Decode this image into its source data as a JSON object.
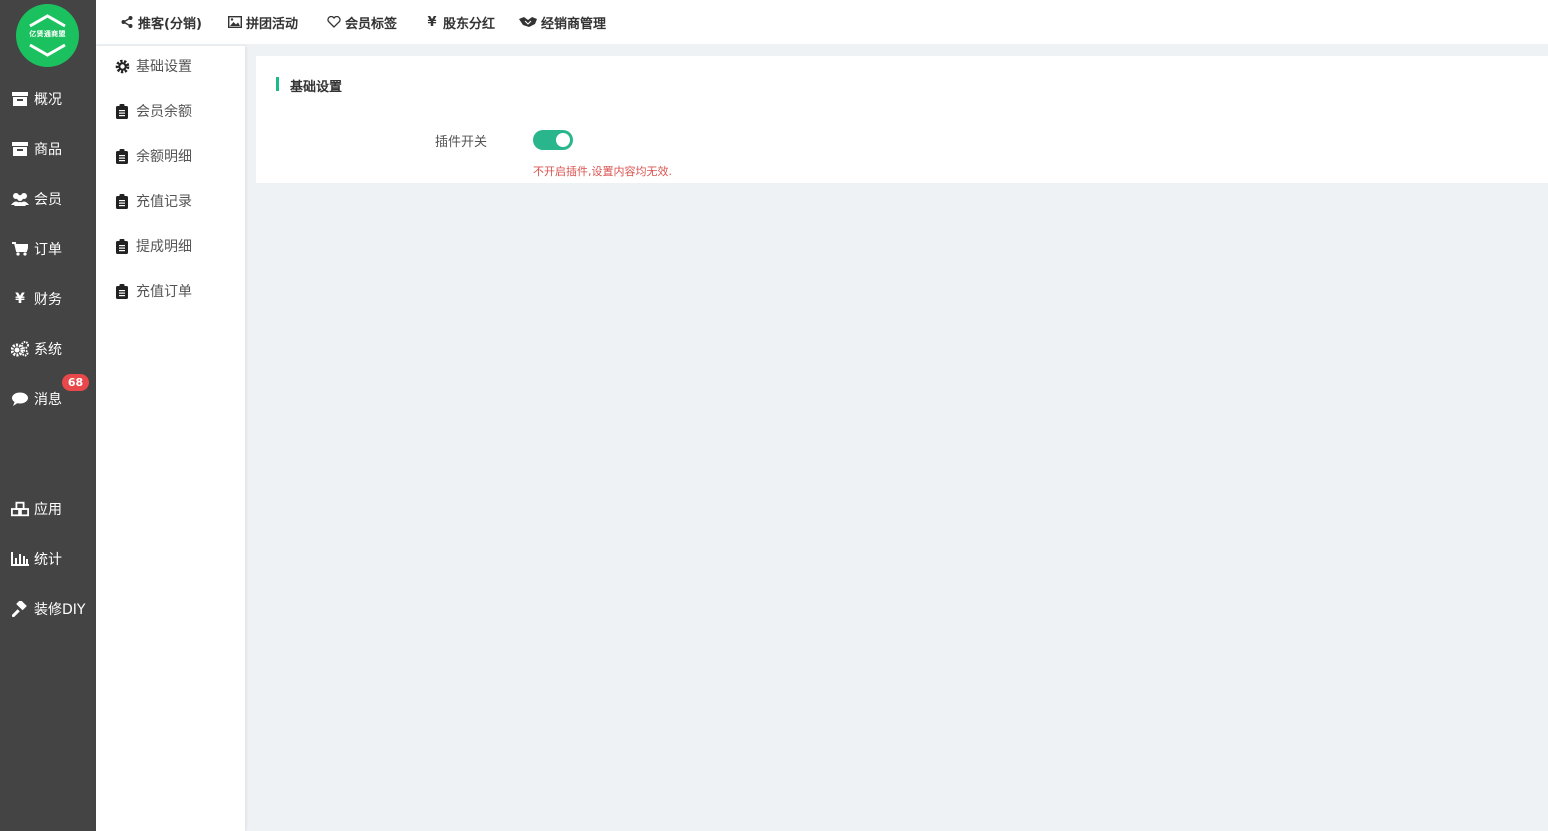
{
  "logo": {
    "text": "亿贤通商盟",
    "brand_color": "#1cc15f"
  },
  "nav": {
    "items": [
      {
        "label": "概况",
        "icon": "archive-icon"
      },
      {
        "label": "商品",
        "icon": "archive-icon"
      },
      {
        "label": "会员",
        "icon": "users-icon"
      },
      {
        "label": "订单",
        "icon": "cart-icon"
      },
      {
        "label": "财务",
        "icon": "yen-icon"
      },
      {
        "label": "系统",
        "icon": "gears-icon"
      },
      {
        "label": "消息",
        "icon": "chat-icon",
        "badge": "68"
      },
      {
        "label": "应用",
        "icon": "cubes-icon"
      },
      {
        "label": "统计",
        "icon": "bar-chart-icon"
      },
      {
        "label": "装修DIY",
        "icon": "hammer-icon"
      }
    ]
  },
  "topbar": {
    "items": [
      {
        "label": "推客(分销)",
        "icon": "share-icon"
      },
      {
        "label": "拼团活动",
        "icon": "image-icon"
      },
      {
        "label": "会员标签",
        "icon": "heart-icon"
      },
      {
        "label": "股东分红",
        "icon": "yen-icon"
      },
      {
        "label": "经销商管理",
        "icon": "handshake-icon"
      }
    ]
  },
  "submenu": {
    "items": [
      {
        "label": "基础设置",
        "icon": "gear-icon"
      },
      {
        "label": "会员余额",
        "icon": "clipboard-icon"
      },
      {
        "label": "余额明细",
        "icon": "clipboard-icon"
      },
      {
        "label": "充值记录",
        "icon": "clipboard-icon"
      },
      {
        "label": "提成明细",
        "icon": "clipboard-icon"
      },
      {
        "label": "充值订单",
        "icon": "clipboard-icon"
      }
    ]
  },
  "content": {
    "section_title": "基础设置",
    "plugin_switch": {
      "label": "插件开关",
      "enabled": true,
      "hint": "不开启插件,设置内容均无效."
    },
    "accent_color": "#1cb98a",
    "toggle_color": "#2ab68c",
    "hint_color": "#d9534f"
  }
}
